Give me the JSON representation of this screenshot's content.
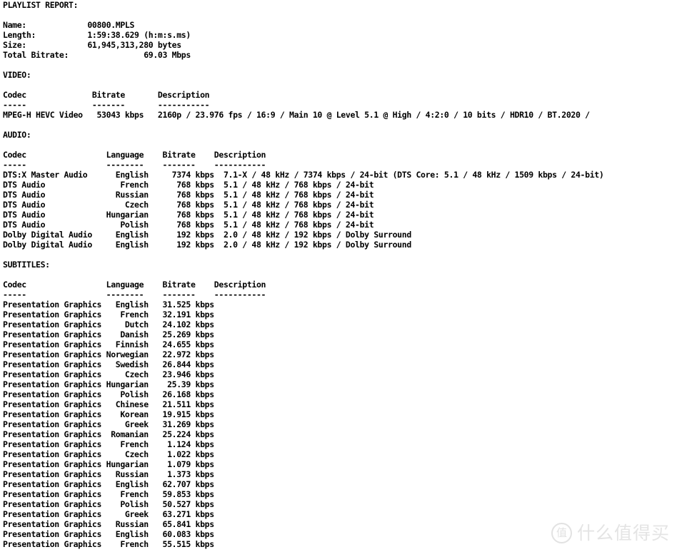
{
  "report": {
    "title": "PLAYLIST REPORT:",
    "summary": {
      "label_name": "Name:",
      "value_name": "00800.MPLS",
      "label_length": "Length:",
      "value_length": "1:59:38.629 (h:m:s.ms)",
      "label_size": "Size:",
      "value_size": "61,945,313,280 bytes",
      "label_total_bitrate": "Total Bitrate:",
      "value_total_bitrate": "69.03 Mbps"
    },
    "video": {
      "section_title": "VIDEO:",
      "headers": {
        "codec": "Codec",
        "bitrate": "Bitrate",
        "description": "Description"
      },
      "rules": {
        "codec": "-----",
        "bitrate": "-------",
        "description": "-----------"
      },
      "tracks": [
        {
          "codec": "MPEG-H HEVC Video",
          "bitrate": "53043 kbps",
          "description": "2160p / 23.976 fps / 16:9 / Main 10 @ Level 5.1 @ High / 4:2:0 / 10 bits / HDR10 / BT.2020 /"
        }
      ]
    },
    "audio": {
      "section_title": "AUDIO:",
      "headers": {
        "codec": "Codec",
        "language": "Language",
        "bitrate": "Bitrate",
        "description": "Description"
      },
      "rules": {
        "codec": "-----",
        "language": "--------",
        "bitrate": "-------",
        "description": "-----------"
      },
      "tracks": [
        {
          "codec": "DTS:X Master Audio",
          "language": "English",
          "bitrate": "7374 kbps",
          "description": "7.1-X / 48 kHz / 7374 kbps / 24-bit (DTS Core: 5.1 / 48 kHz / 1509 kbps / 24-bit)"
        },
        {
          "codec": "DTS Audio",
          "language": "French",
          "bitrate": "768 kbps",
          "description": "5.1 / 48 kHz / 768 kbps / 24-bit"
        },
        {
          "codec": "DTS Audio",
          "language": "Russian",
          "bitrate": "768 kbps",
          "description": "5.1 / 48 kHz / 768 kbps / 24-bit"
        },
        {
          "codec": "DTS Audio",
          "language": "Czech",
          "bitrate": "768 kbps",
          "description": "5.1 / 48 kHz / 768 kbps / 24-bit"
        },
        {
          "codec": "DTS Audio",
          "language": "Hungarian",
          "bitrate": "768 kbps",
          "description": "5.1 / 48 kHz / 768 kbps / 24-bit"
        },
        {
          "codec": "DTS Audio",
          "language": "Polish",
          "bitrate": "768 kbps",
          "description": "5.1 / 48 kHz / 768 kbps / 24-bit"
        },
        {
          "codec": "Dolby Digital Audio",
          "language": "English",
          "bitrate": "192 kbps",
          "description": "2.0 / 48 kHz / 192 kbps / Dolby Surround"
        },
        {
          "codec": "Dolby Digital Audio",
          "language": "English",
          "bitrate": "192 kbps",
          "description": "2.0 / 48 kHz / 192 kbps / Dolby Surround"
        }
      ]
    },
    "subtitles": {
      "section_title": "SUBTITLES:",
      "headers": {
        "codec": "Codec",
        "language": "Language",
        "bitrate": "Bitrate",
        "description": "Description"
      },
      "rules": {
        "codec": "-----",
        "language": "--------",
        "bitrate": "-------",
        "description": "-----------"
      },
      "tracks": [
        {
          "codec": "Presentation Graphics",
          "language": "English",
          "bitrate": "31.525 kbps",
          "description": ""
        },
        {
          "codec": "Presentation Graphics",
          "language": "French",
          "bitrate": "32.191 kbps",
          "description": ""
        },
        {
          "codec": "Presentation Graphics",
          "language": "Dutch",
          "bitrate": "24.102 kbps",
          "description": ""
        },
        {
          "codec": "Presentation Graphics",
          "language": "Danish",
          "bitrate": "25.269 kbps",
          "description": ""
        },
        {
          "codec": "Presentation Graphics",
          "language": "Finnish",
          "bitrate": "24.655 kbps",
          "description": ""
        },
        {
          "codec": "Presentation Graphics",
          "language": "Norwegian",
          "bitrate": "22.972 kbps",
          "description": ""
        },
        {
          "codec": "Presentation Graphics",
          "language": "Swedish",
          "bitrate": "26.844 kbps",
          "description": ""
        },
        {
          "codec": "Presentation Graphics",
          "language": "Czech",
          "bitrate": "23.946 kbps",
          "description": ""
        },
        {
          "codec": "Presentation Graphics",
          "language": "Hungarian",
          "bitrate": "25.39 kbps",
          "description": ""
        },
        {
          "codec": "Presentation Graphics",
          "language": "Polish",
          "bitrate": "26.168 kbps",
          "description": ""
        },
        {
          "codec": "Presentation Graphics",
          "language": "Chinese",
          "bitrate": "21.511 kbps",
          "description": ""
        },
        {
          "codec": "Presentation Graphics",
          "language": "Korean",
          "bitrate": "19.915 kbps",
          "description": ""
        },
        {
          "codec": "Presentation Graphics",
          "language": "Greek",
          "bitrate": "31.269 kbps",
          "description": ""
        },
        {
          "codec": "Presentation Graphics",
          "language": "Romanian",
          "bitrate": "25.224 kbps",
          "description": ""
        },
        {
          "codec": "Presentation Graphics",
          "language": "French",
          "bitrate": "1.124 kbps",
          "description": ""
        },
        {
          "codec": "Presentation Graphics",
          "language": "Czech",
          "bitrate": "1.022 kbps",
          "description": ""
        },
        {
          "codec": "Presentation Graphics",
          "language": "Hungarian",
          "bitrate": "1.079 kbps",
          "description": ""
        },
        {
          "codec": "Presentation Graphics",
          "language": "Russian",
          "bitrate": "1.373 kbps",
          "description": ""
        },
        {
          "codec": "Presentation Graphics",
          "language": "English",
          "bitrate": "62.707 kbps",
          "description": ""
        },
        {
          "codec": "Presentation Graphics",
          "language": "French",
          "bitrate": "59.853 kbps",
          "description": ""
        },
        {
          "codec": "Presentation Graphics",
          "language": "Polish",
          "bitrate": "50.527 kbps",
          "description": ""
        },
        {
          "codec": "Presentation Graphics",
          "language": "Greek",
          "bitrate": "63.271 kbps",
          "description": ""
        },
        {
          "codec": "Presentation Graphics",
          "language": "Russian",
          "bitrate": "65.841 kbps",
          "description": ""
        },
        {
          "codec": "Presentation Graphics",
          "language": "English",
          "bitrate": "60.083 kbps",
          "description": ""
        },
        {
          "codec": "Presentation Graphics",
          "language": "French",
          "bitrate": "55.515 kbps",
          "description": ""
        }
      ]
    }
  },
  "watermark": {
    "badge": "值",
    "text": "什么值得买"
  },
  "layout": {
    "summary_label_width": 18,
    "summary_value_width": 22,
    "video_codec_width": 19,
    "video_bitrate_width": 14,
    "av_codec_width": 22,
    "av_language_width": 12,
    "av_bitrate_width": 14
  },
  "colors": {
    "background": "#ffffff",
    "text": "#000000",
    "watermark": "#e4e4e4"
  }
}
